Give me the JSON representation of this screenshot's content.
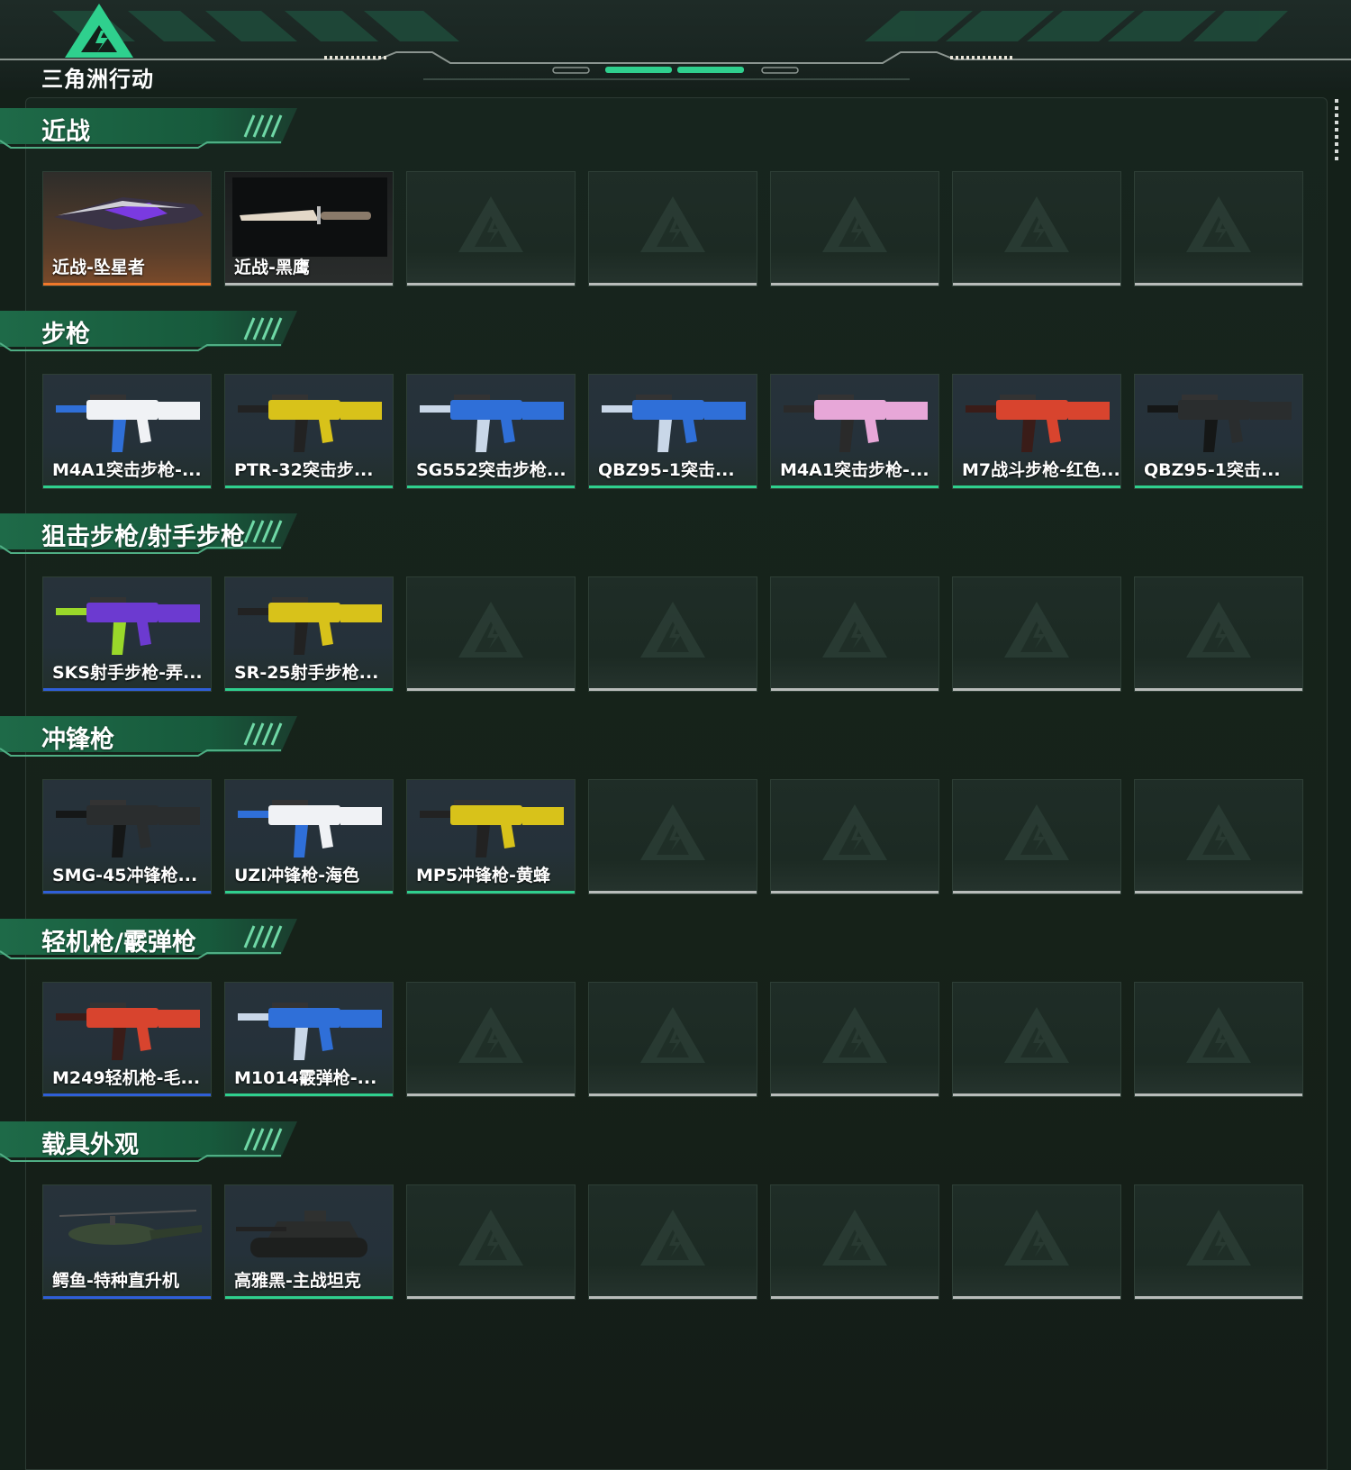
{
  "app": {
    "logo_text": "三角洲行动"
  },
  "colors": {
    "accent": "#2fd08e",
    "rarity_orange": "#f0782a",
    "rarity_blue": "#2f5fd8",
    "rarity_green": "#2fd08e",
    "empty_bar": "#b8bcba"
  },
  "sections": [
    {
      "title": "近战",
      "items": [
        {
          "label": "近战-坠星者",
          "rarity": "orange",
          "icon": "purple-blade-icon"
        },
        {
          "label": "近战-黑鹰",
          "rarity": "empty",
          "icon": "knife-icon"
        }
      ]
    },
    {
      "title": "步枪",
      "items": [
        {
          "label": "M4A1突击步枪-...",
          "rarity": "green",
          "icon": "assault-rifle-blue-white-icon"
        },
        {
          "label": "PTR-32突击步...",
          "rarity": "green",
          "icon": "assault-rifle-yellow-icon"
        },
        {
          "label": "SG552突击步枪...",
          "rarity": "green",
          "icon": "assault-rifle-blue-camo-icon"
        },
        {
          "label": "QBZ95-1突击...",
          "rarity": "green",
          "icon": "bullpup-rifle-blue-icon"
        },
        {
          "label": "M4A1突击步枪-...",
          "rarity": "green",
          "icon": "assault-rifle-pink-icon"
        },
        {
          "label": "M7战斗步枪-红色...",
          "rarity": "green",
          "icon": "battle-rifle-red-icon"
        },
        {
          "label": "QBZ95-1突击...",
          "rarity": "green",
          "icon": "bullpup-rifle-black-icon"
        }
      ]
    },
    {
      "title": "狙击步枪/射手步枪",
      "items": [
        {
          "label": "SKS射手步枪-弄...",
          "rarity": "blue",
          "icon": "marksman-rifle-purple-green-icon"
        },
        {
          "label": "SR-25射手步枪...",
          "rarity": "green",
          "icon": "marksman-rifle-yellow-icon"
        }
      ]
    },
    {
      "title": "冲锋枪",
      "items": [
        {
          "label": "SMG-45冲锋枪...",
          "rarity": "blue",
          "icon": "smg-dark-green-icon"
        },
        {
          "label": "UZI冲锋枪-海色",
          "rarity": "green",
          "icon": "smg-white-blue-icon"
        },
        {
          "label": "MP5冲锋枪-黄蜂",
          "rarity": "green",
          "icon": "smg-yellow-black-icon"
        }
      ]
    },
    {
      "title": "轻机枪/霰弹枪",
      "items": [
        {
          "label": "M249轻机枪-毛...",
          "rarity": "blue",
          "icon": "lmg-red-icon"
        },
        {
          "label": "M1014霰弹枪-...",
          "rarity": "green",
          "icon": "shotgun-blue-icon"
        }
      ]
    },
    {
      "title": "载具外观",
      "items": [
        {
          "label": "鳄鱼-特种直升机",
          "rarity": "blue",
          "icon": "helicopter-icon"
        },
        {
          "label": "高雅黑-主战坦克",
          "rarity": "green",
          "icon": "tank-icon"
        }
      ]
    }
  ]
}
